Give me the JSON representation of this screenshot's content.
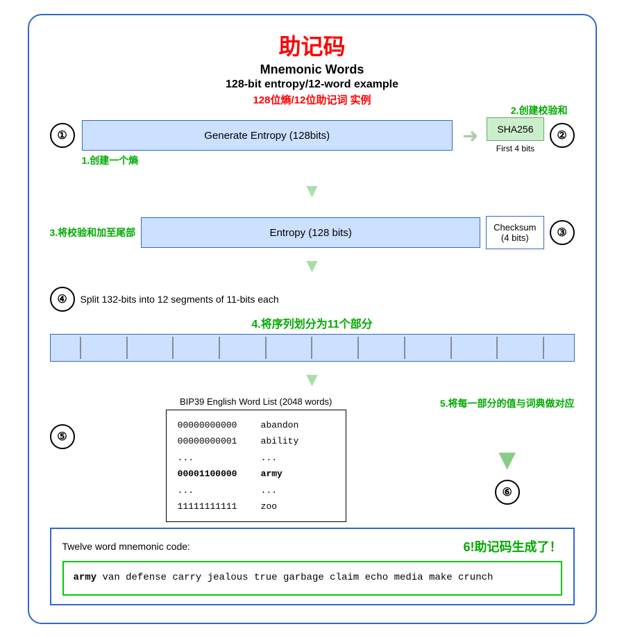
{
  "title": {
    "cn": "助记码",
    "en1": "Mnemonic Words",
    "en2": "128-bit entropy/12-word example",
    "cn2": "128位熵/12位助记词 实例"
  },
  "labels": {
    "label1": "1.创建一个熵",
    "label2": "2.创建校验和",
    "label3": "3.将校验和加至尾部",
    "label4cn": "4.将序列划分为11个部分",
    "label5cn": "5.将每一部分的值与词典做对应",
    "label6cn": "6!助记码生成了！"
  },
  "step1": {
    "circle": "①",
    "box_text": "Generate Entropy (128bits)"
  },
  "step2": {
    "circle": "②",
    "sha_label": "SHA256",
    "first4": "First 4 bits"
  },
  "step3": {
    "circle": "③",
    "entropy_label": "Entropy (128 bits)",
    "checksum_label": "Checksum\n(4 bits)"
  },
  "step4": {
    "circle": "④",
    "split_text": "Split 132-bits into 12 segments of 11-bits each",
    "segments": 12
  },
  "step5": {
    "circle": "⑤",
    "bip39_title": "BIP39 English Word List (2048 words)",
    "rows": [
      {
        "bits": "00000000000",
        "word": "abandon"
      },
      {
        "bits": "00000000001",
        "word": "ability"
      },
      {
        "bits": "...",
        "word": "..."
      },
      {
        "bits": "00001100000",
        "word": "army",
        "bold": true
      },
      {
        "bits": "...",
        "word": "..."
      },
      {
        "bits": "11111111111",
        "word": "zoo"
      }
    ]
  },
  "step6": {
    "circle": "⑥",
    "mnemonic_title": "Twelve word mnemonic code:",
    "mnemonic_word1": "army",
    "mnemonic_rest": " van defense carry jealous true\ngarbage claim echo media make crunch"
  }
}
